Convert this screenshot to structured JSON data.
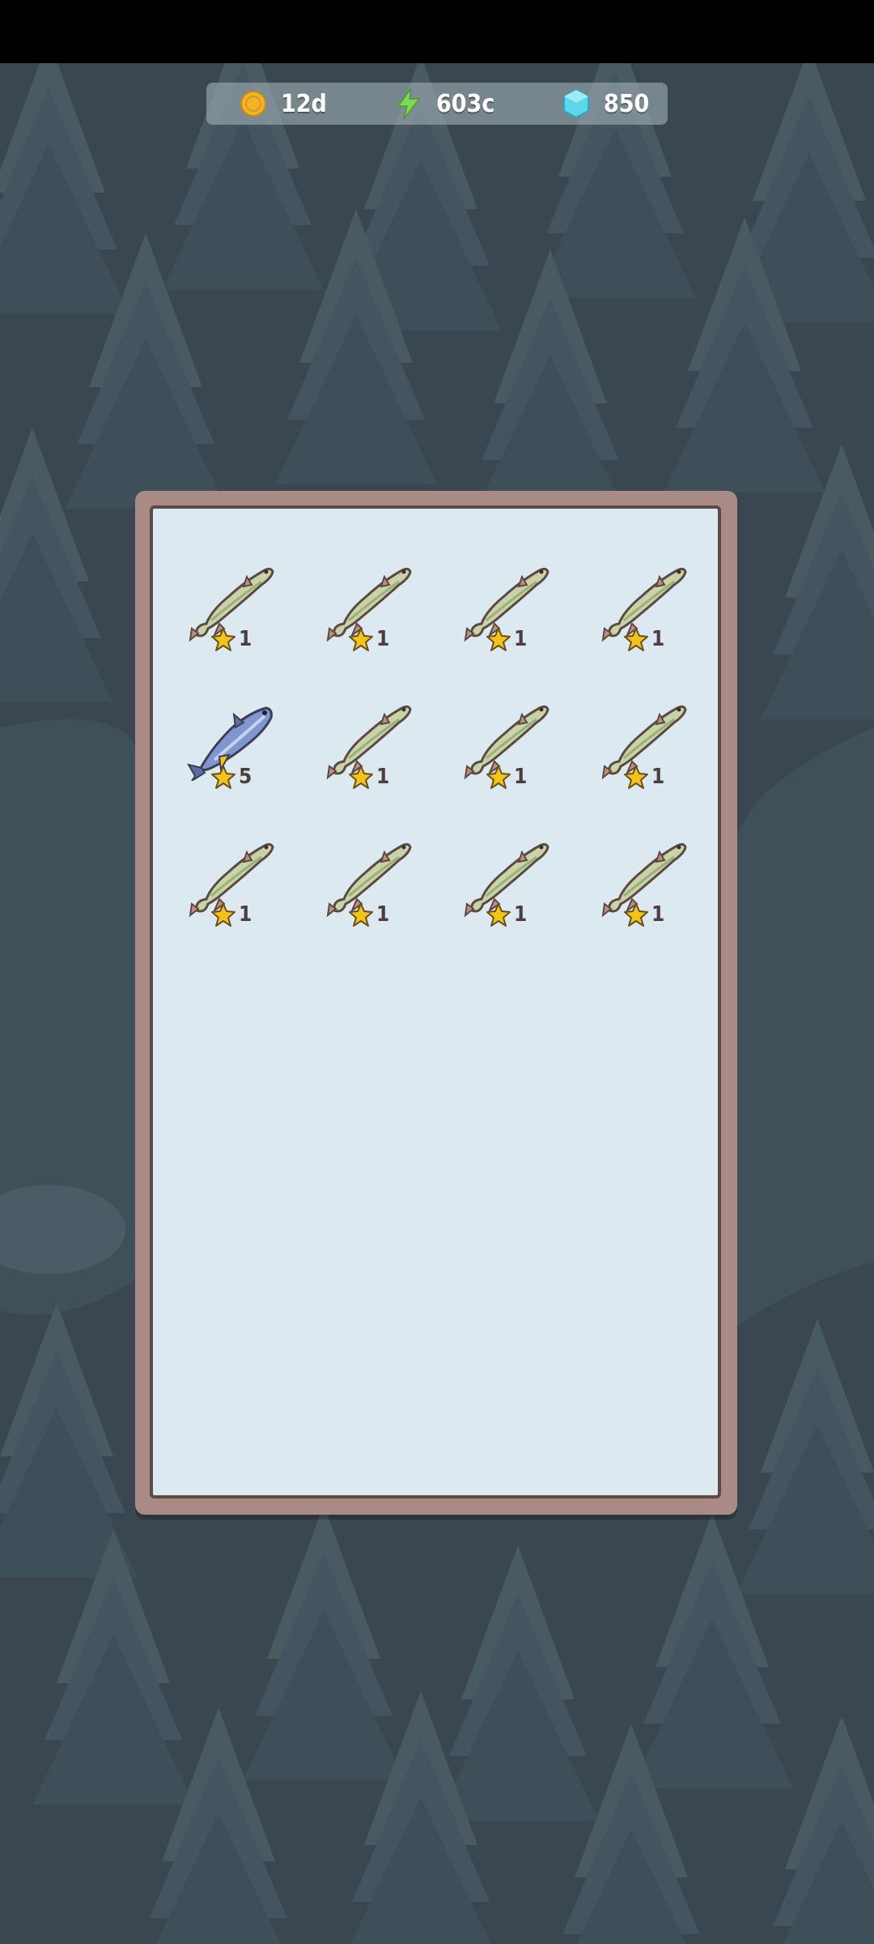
{
  "hud": {
    "coins": {
      "icon": "coin-icon",
      "value": "12d"
    },
    "energy": {
      "icon": "lightning-icon",
      "value": "603c"
    },
    "gems": {
      "icon": "gem-icon",
      "value": "850"
    }
  },
  "inventory": {
    "items": [
      {
        "icon": "pike-fish-icon",
        "stars": "1"
      },
      {
        "icon": "pike-fish-icon",
        "stars": "1"
      },
      {
        "icon": "pike-fish-icon",
        "stars": "1"
      },
      {
        "icon": "pike-fish-icon",
        "stars": "1"
      },
      {
        "icon": "tuna-fish-icon",
        "stars": "5"
      },
      {
        "icon": "pike-fish-icon",
        "stars": "1"
      },
      {
        "icon": "pike-fish-icon",
        "stars": "1"
      },
      {
        "icon": "pike-fish-icon",
        "stars": "1"
      },
      {
        "icon": "pike-fish-icon",
        "stars": "1"
      },
      {
        "icon": "pike-fish-icon",
        "stars": "1"
      },
      {
        "icon": "pike-fish-icon",
        "stars": "1"
      },
      {
        "icon": "pike-fish-icon",
        "stars": "1"
      }
    ]
  },
  "colors": {
    "background": "#3b4851",
    "panel_frame": "#a98a85",
    "panel_inner": "#dce9f1",
    "star": "#f2c318",
    "pike_body": "#c9d3a8",
    "tuna_body": "#7f97d0"
  }
}
